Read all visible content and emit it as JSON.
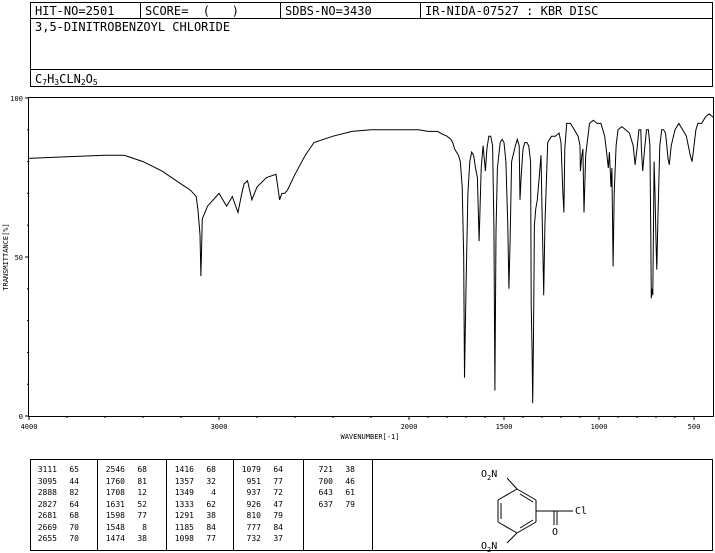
{
  "header": {
    "hit_no": "HIT-NO=2501",
    "score": "SCORE=  (   )",
    "sdbs_no": "SDBS-NO=3430",
    "nida": "IR-NIDA-07527 : KBR DISC"
  },
  "compound": {
    "name": "3,5-DINITROBENZOYL CHLORIDE",
    "formula_parts": [
      {
        "t": "C",
        "sub": false
      },
      {
        "t": "7",
        "sub": true
      },
      {
        "t": "H",
        "sub": false
      },
      {
        "t": "3",
        "sub": true
      },
      {
        "t": "CLN",
        "sub": false
      },
      {
        "t": "2",
        "sub": true
      },
      {
        "t": "O",
        "sub": false
      },
      {
        "t": "5",
        "sub": true
      }
    ]
  },
  "chart_data": {
    "type": "line",
    "xlabel": "WAVENUMBER[-1]",
    "ylabel": "TRANSMITTANCE[%]",
    "xlim": [
      4000,
      400
    ],
    "ylim": [
      0,
      100
    ],
    "xticks": [
      4000,
      3000,
      2000,
      1500,
      1000,
      500
    ],
    "xtick_labels": [
      "4000",
      "3000",
      "2000",
      "1500",
      "1000",
      "500"
    ],
    "yticks": [
      0,
      50,
      100
    ],
    "ytick_labels": [
      "0",
      "50",
      "100"
    ],
    "series": [
      {
        "x": [
          4000,
          3800,
          3600,
          3500,
          3400,
          3300,
          3200,
          3150,
          3120,
          3111,
          3100,
          3095,
          3088,
          3060,
          3000,
          2960,
          2930,
          2900,
          2880,
          2868,
          2850,
          2827,
          2800,
          2750,
          2700,
          2681,
          2669,
          2655,
          2640,
          2600,
          2546,
          2500,
          2400,
          2300,
          2200,
          2100,
          2000,
          1950,
          1900,
          1850,
          1820,
          1800,
          1780,
          1770,
          1760,
          1750,
          1740,
          1730,
          1720,
          1712,
          1708,
          1700,
          1690,
          1680,
          1670,
          1660,
          1650,
          1640,
          1631,
          1620,
          1610,
          1598,
          1590,
          1580,
          1570,
          1560,
          1553,
          1548,
          1542,
          1535,
          1520,
          1510,
          1500,
          1490,
          1480,
          1474,
          1468,
          1460,
          1440,
          1430,
          1420,
          1416,
          1410,
          1400,
          1390,
          1380,
          1370,
          1360,
          1357,
          1352,
          1349,
          1345,
          1340,
          1333,
          1325,
          1315,
          1305,
          1300,
          1295,
          1291,
          1285,
          1270,
          1250,
          1230,
          1210,
          1200,
          1190,
          1185,
          1180,
          1170,
          1150,
          1130,
          1110,
          1100,
          1098,
          1090,
          1085,
          1079,
          1070,
          1050,
          1030,
          1010,
          990,
          980,
          970,
          960,
          951,
          945,
          937,
          932,
          926,
          920,
          910,
          900,
          880,
          860,
          840,
          820,
          810,
          800,
          790,
          780,
          777,
          770,
          760,
          750,
          740,
          732,
          728,
          725,
          721,
          717,
          713,
          710,
          705,
          700,
          696,
          690,
          680,
          670,
          660,
          650,
          643,
          637,
          630,
          620,
          600,
          580,
          560,
          540,
          520,
          510,
          500,
          490,
          480,
          460,
          440,
          420,
          400
        ],
        "values": [
          81,
          81.5,
          82,
          82,
          80,
          77,
          73,
          71,
          69,
          65,
          57,
          44,
          62,
          66,
          70,
          66,
          69,
          64,
          70,
          73,
          74,
          68,
          72,
          75,
          76,
          68,
          70,
          70,
          71,
          76,
          82,
          86,
          88,
          89.5,
          90,
          90,
          90,
          90,
          89.5,
          89.5,
          88.5,
          88,
          87,
          86,
          84,
          83,
          82,
          80,
          72,
          50,
          12,
          40,
          70,
          80,
          83,
          82,
          78,
          75,
          55,
          78,
          85,
          77,
          84,
          88,
          88,
          85,
          60,
          8,
          58,
          78,
          86,
          87,
          86,
          80,
          60,
          40,
          55,
          80,
          85,
          87,
          85,
          68,
          75,
          84,
          86,
          86,
          85,
          80,
          35,
          20,
          4,
          25,
          60,
          65,
          68,
          75,
          82,
          65,
          50,
          38,
          60,
          86,
          88,
          88,
          89,
          86,
          70,
          64,
          84,
          92,
          92,
          90,
          88,
          85,
          77,
          82,
          84,
          64,
          82,
          92,
          93,
          92,
          92,
          90,
          88,
          83,
          78,
          83,
          72,
          78,
          47,
          70,
          85,
          90,
          91,
          90,
          89,
          85,
          79,
          84,
          90,
          90,
          84,
          77,
          84,
          90,
          90,
          85,
          60,
          37,
          40,
          38,
          60,
          80,
          70,
          55,
          46,
          62,
          85,
          90,
          90,
          89,
          85,
          81,
          79,
          85,
          90,
          92,
          90,
          88,
          82,
          80,
          85,
          90,
          92,
          92,
          94,
          95,
          94
        ]
      }
    ]
  },
  "peak_table": [
    [
      [
        3111,
        65
      ],
      [
        3095,
        44
      ],
      [
        2888,
        82
      ],
      [
        2827,
        64
      ],
      [
        2681,
        68
      ],
      [
        2669,
        70
      ],
      [
        2655,
        70
      ]
    ],
    [
      [
        2546,
        68
      ],
      [
        1760,
        81
      ],
      [
        1708,
        12
      ],
      [
        1631,
        52
      ],
      [
        1598,
        77
      ],
      [
        1548,
        8
      ],
      [
        1474,
        38
      ]
    ],
    [
      [
        1416,
        68
      ],
      [
        1357,
        32
      ],
      [
        1349,
        4
      ],
      [
        1333,
        62
      ],
      [
        1291,
        38
      ],
      [
        1185,
        84
      ],
      [
        1098,
        77
      ]
    ],
    [
      [
        1079,
        64
      ],
      [
        951,
        77
      ],
      [
        937,
        72
      ],
      [
        926,
        47
      ],
      [
        810,
        79
      ],
      [
        777,
        84
      ],
      [
        732,
        37
      ]
    ],
    [
      [
        721,
        38
      ],
      [
        700,
        46
      ],
      [
        643,
        61
      ],
      [
        637,
        79
      ]
    ]
  ],
  "structure_labels": {
    "nitro_top": "O",
    "nitro_top_n": "N",
    "nitro_top_sub": "2",
    "nitro_bottom": "O",
    "nitro_bottom_n": "N",
    "nitro_bottom_sub": "2",
    "carbonyl_o": "O",
    "chlorine": "Cl"
  }
}
